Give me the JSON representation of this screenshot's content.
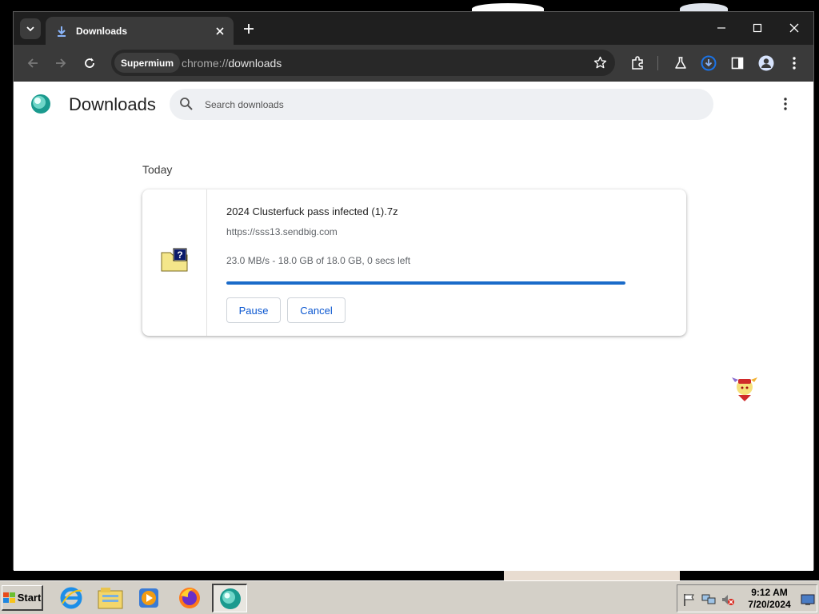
{
  "window": {
    "tab_title": "Downloads",
    "controls": {
      "minimize": "minimize",
      "maximize": "maximize",
      "close": "close"
    }
  },
  "toolbar": {
    "browser_chip": "Supermium",
    "url_scheme": "chrome://",
    "url_path": "downloads"
  },
  "page": {
    "title": "Downloads",
    "search_placeholder": "Search downloads",
    "section_label": "Today"
  },
  "download": {
    "file_name": "2024 Clusterfuck pass infected (1).7z",
    "source_url": "https://sss13.sendbig.com",
    "status": "23.0 MB/s - 18.0 GB of 18.0 GB, 0 secs left",
    "progress_fraction": 1.0,
    "pause_label": "Pause",
    "cancel_label": "Cancel"
  },
  "taskbar": {
    "start_label": "Start",
    "apps": [
      "internet-explorer",
      "file-explorer",
      "media-player",
      "firefox",
      "supermium"
    ],
    "clock_time": "9:12 AM",
    "clock_date": "7/20/2024"
  },
  "colors": {
    "accent": "#0b57d0",
    "progress": "#1a6bc9",
    "titlebar": "#1f1f1f",
    "toolbar": "#3a3a3a"
  }
}
